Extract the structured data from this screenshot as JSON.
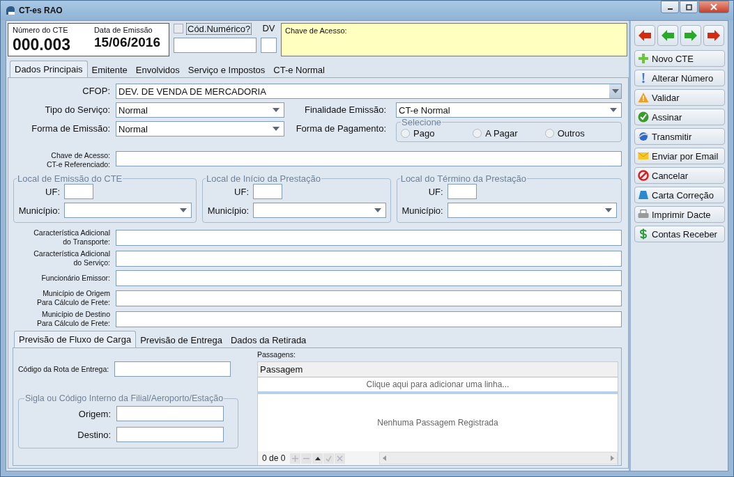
{
  "window": {
    "title": "CT-es RAO"
  },
  "header": {
    "numero_label": "Número do CTE",
    "numero": "000.003",
    "data_label": "Data de Emissão",
    "data": "15/06/2016",
    "cod_numerico": {
      "label": "Cód.Numérico?",
      "checked": false
    },
    "dv_label": "DV",
    "chave_label": "Chave de Acesso:"
  },
  "tabs": [
    {
      "label": "Dados Principais",
      "selected": true
    },
    {
      "label": "Emitente",
      "selected": false
    },
    {
      "label": "Envolvidos",
      "selected": false
    },
    {
      "label": "Serviço e Impostos",
      "selected": false
    },
    {
      "label": "CT-e Normal",
      "selected": false
    }
  ],
  "cfop": {
    "label": "CFOP:",
    "value": "DEV. DE VENDA DE MERCADORIA"
  },
  "tipo_servico": {
    "label": "Tipo do Serviço:",
    "value": "Normal"
  },
  "finalidade_emissao": {
    "label": "Finalidade Emissão:",
    "value": "CT-e Normal"
  },
  "forma_emissao": {
    "label": "Forma de Emissão:",
    "value": "Normal"
  },
  "forma_pagamento": {
    "label": "Forma de Pagamento:",
    "group_title": "Selecione",
    "options": [
      {
        "label": "Pago",
        "selected": false
      },
      {
        "label": "A Pagar",
        "selected": false
      },
      {
        "label": "Outros",
        "selected": false
      }
    ]
  },
  "chave_referenciado": {
    "label": "Chave de Acesso:\nCT-e Referenciado:"
  },
  "locations": [
    {
      "title": "Local de Emissão do CTE",
      "uf_label": "UF:",
      "municipio_label": "Município:"
    },
    {
      "title": "Local de Início da Prestação",
      "uf_label": "UF:",
      "municipio_label": "Município:"
    },
    {
      "title": "Local do Término da Prestação",
      "uf_label": "UF:",
      "municipio_label": "Município:"
    }
  ],
  "extra_fields": [
    {
      "label": "Característica Adicional\ndo Transporte:"
    },
    {
      "label": "Característica Adicional\ndo Serviço:"
    },
    {
      "label": "Funcionário Emissor:"
    },
    {
      "label": "Município de Origem\nPara Cálculo de Frete:"
    },
    {
      "label": "Município de Destino\nPara Cálculo de Frete:"
    }
  ],
  "sub_tabs": [
    {
      "label": "Previsão de Fluxo de Carga",
      "selected": true
    },
    {
      "label": "Previsão de Entrega",
      "selected": false
    },
    {
      "label": "Dados da Retirada",
      "selected": false
    }
  ],
  "rota": {
    "label": "Código da Rota de Entrega:"
  },
  "filial_group": {
    "title": "Sigla ou Código Interno da Filial/Aeroporto/Estação",
    "origem_label": "Origem:",
    "destino_label": "Destino:"
  },
  "passagens": {
    "label": "Passagens:",
    "column": "Passagem",
    "add_hint": "Clique aqui para adicionar uma linha...",
    "empty": "Nenhuma Passagem Registrada",
    "pager": "0 de 0"
  },
  "nav_buttons": [
    {
      "kind": "left",
      "color": "#d42a10"
    },
    {
      "kind": "left",
      "color": "#2aa82a"
    },
    {
      "kind": "right",
      "color": "#2aa82a"
    },
    {
      "kind": "right",
      "color": "#d42a10"
    }
  ],
  "actions": [
    {
      "label": "Novo CTE",
      "kind": "plus"
    },
    {
      "label": "Alterar Número",
      "kind": "exclamation"
    },
    {
      "label": "Validar",
      "kind": "warning"
    },
    {
      "label": "Assinar",
      "kind": "check"
    },
    {
      "label": "Transmitir",
      "kind": "globe"
    },
    {
      "label": "Enviar por Email",
      "kind": "envelope"
    },
    {
      "label": "Cancelar",
      "kind": "cancel"
    },
    {
      "label": "Carta Correção",
      "kind": "trapezoid"
    },
    {
      "label": "Imprimir Dacte",
      "kind": "printer"
    },
    {
      "label": "Contas Receber",
      "kind": "dollar"
    }
  ]
}
